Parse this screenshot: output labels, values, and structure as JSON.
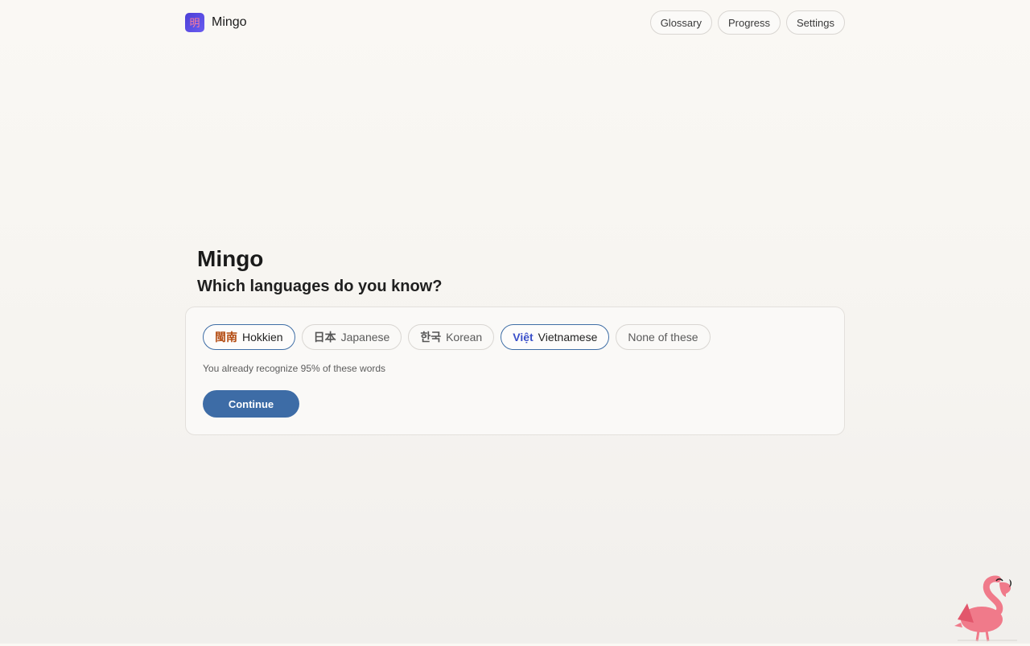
{
  "brand": {
    "icon_glyph": "明",
    "name": "Mingo"
  },
  "nav": {
    "items": [
      {
        "label": "Glossary"
      },
      {
        "label": "Progress"
      },
      {
        "label": "Settings"
      }
    ]
  },
  "onboarding": {
    "title": "Mingo",
    "question": "Which languages do you know?",
    "languages": [
      {
        "script": "閩南",
        "label": "Hokkien",
        "selected": true
      },
      {
        "script": "日本",
        "label": "Japanese",
        "selected": false
      },
      {
        "script": "한국",
        "label": "Korean",
        "selected": false
      },
      {
        "script": "Việt",
        "label": "Vietnamese",
        "selected": true
      },
      {
        "script": "",
        "label": "None of these",
        "selected": false
      }
    ],
    "recognition_text": "You already recognize 95% of these words",
    "continue_label": "Continue"
  },
  "colors": {
    "accent": "#3d6ca6",
    "brand": "#4b3fd6",
    "mascot": "#f07a8a"
  },
  "mascot_icon": "flamingo-icon"
}
